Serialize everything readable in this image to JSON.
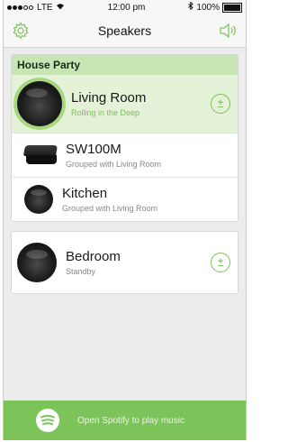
{
  "status_bar": {
    "carrier": "LTE",
    "time": "12:00 pm",
    "battery": "100%",
    "battery_level": 1.0
  },
  "nav": {
    "title": "Speakers",
    "left_icon": "gear-icon",
    "right_icon": "speaker-volume-icon"
  },
  "group": {
    "name": "House Party",
    "main": {
      "name": "Living Room",
      "subtitle": "Rolling in the Deep"
    },
    "members": [
      {
        "name": "SW100M",
        "subtitle": "Grouped with Living Room"
      },
      {
        "name": "Kitchen",
        "subtitle": "Grouped with Living Room"
      }
    ]
  },
  "standalone": {
    "name": "Bedroom",
    "subtitle": "Standby"
  },
  "footer": {
    "label": "Open Spotify to play music"
  },
  "colors": {
    "accent_green": "#7cc35a",
    "group_header_bg": "#c8e6b3",
    "active_row_bg": "#e4f3d8"
  }
}
